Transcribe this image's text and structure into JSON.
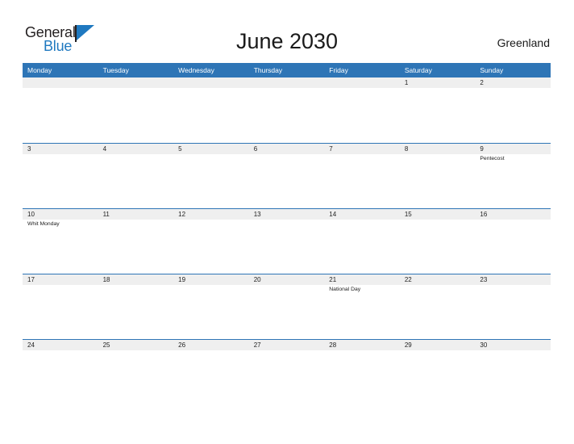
{
  "brand": {
    "name_top": "General",
    "name_bottom": "Blue",
    "flag_icon": "flag-triangle-icon",
    "accent_color": "#1f79c0"
  },
  "header": {
    "title": "June 2030",
    "country": "Greenland"
  },
  "colors": {
    "header_blue": "#2e75b6",
    "row_divider_blue": "#2e75b6",
    "day_strip_gray": "#efefef",
    "page_background": "#ffffff",
    "text": "#1a1a1a"
  },
  "calendar": {
    "month": "June",
    "year": "2030",
    "weekdays": [
      "Monday",
      "Tuesday",
      "Wednesday",
      "Thursday",
      "Friday",
      "Saturday",
      "Sunday"
    ],
    "weeks": [
      [
        {
          "day": ""
        },
        {
          "day": ""
        },
        {
          "day": ""
        },
        {
          "day": ""
        },
        {
          "day": ""
        },
        {
          "day": "1",
          "events": []
        },
        {
          "day": "2",
          "events": []
        }
      ],
      [
        {
          "day": "3",
          "events": []
        },
        {
          "day": "4",
          "events": []
        },
        {
          "day": "5",
          "events": []
        },
        {
          "day": "6",
          "events": []
        },
        {
          "day": "7",
          "events": []
        },
        {
          "day": "8",
          "events": []
        },
        {
          "day": "9",
          "events": [
            "Pentecost"
          ]
        }
      ],
      [
        {
          "day": "10",
          "events": [
            "Whit Monday"
          ]
        },
        {
          "day": "11",
          "events": []
        },
        {
          "day": "12",
          "events": []
        },
        {
          "day": "13",
          "events": []
        },
        {
          "day": "14",
          "events": []
        },
        {
          "day": "15",
          "events": []
        },
        {
          "day": "16",
          "events": []
        }
      ],
      [
        {
          "day": "17",
          "events": []
        },
        {
          "day": "18",
          "events": []
        },
        {
          "day": "19",
          "events": []
        },
        {
          "day": "20",
          "events": []
        },
        {
          "day": "21",
          "events": [
            "National Day"
          ]
        },
        {
          "day": "22",
          "events": []
        },
        {
          "day": "23",
          "events": []
        }
      ],
      [
        {
          "day": "24",
          "events": []
        },
        {
          "day": "25",
          "events": []
        },
        {
          "day": "26",
          "events": []
        },
        {
          "day": "27",
          "events": []
        },
        {
          "day": "28",
          "events": []
        },
        {
          "day": "29",
          "events": []
        },
        {
          "day": "30",
          "events": []
        }
      ]
    ]
  }
}
